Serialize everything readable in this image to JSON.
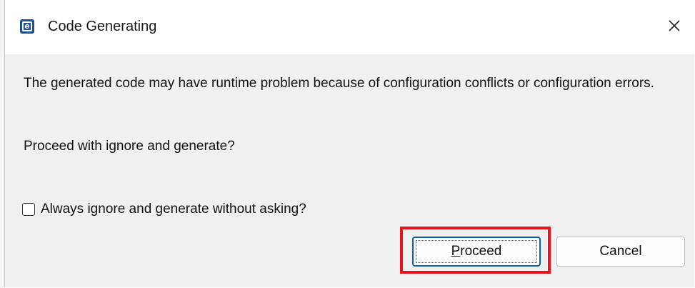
{
  "window": {
    "title": "Code Generating",
    "app_icon": "eclipse-chip-icon",
    "close_icon": "close-icon"
  },
  "dialog": {
    "message": "The generated code may have runtime problem because of configuration conflicts or configuration errors.",
    "question": "Proceed with ignore and generate?",
    "checkbox": {
      "label": "Always ignore and generate without asking?",
      "checked": false
    },
    "buttons": {
      "proceed": "Proceed",
      "cancel": "Cancel"
    }
  },
  "colors": {
    "highlight": "#e8131a",
    "focus_border": "#0a5fb5",
    "content_bg": "#f0f0f0"
  }
}
